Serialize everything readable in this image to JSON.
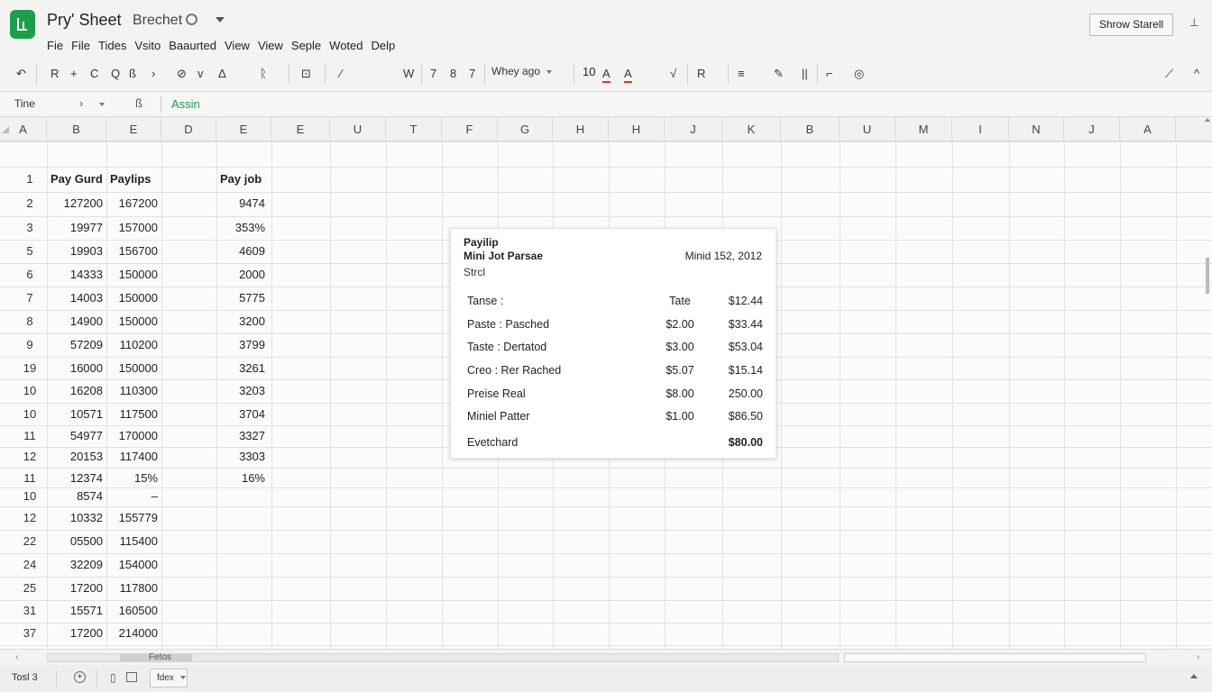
{
  "titlebar": {
    "doc_title": "Pry' Sheet",
    "doc_sub": "Brechet",
    "share_button": "Shrow Starell",
    "pin": "⊥"
  },
  "menu": [
    "Fie",
    "File",
    "Tides",
    "Vsito",
    "Baaurted",
    "View",
    "View",
    "Seple",
    "Woted",
    "Delp"
  ],
  "toolbar": {
    "items": [
      {
        "icon": "undo-icon",
        "glyph": "↶"
      },
      {
        "icon": "redo-icon",
        "glyph": "R"
      },
      {
        "icon": "add-icon",
        "glyph": "+"
      },
      {
        "icon": "refresh-icon",
        "glyph": "C"
      },
      {
        "icon": "search-icon",
        "glyph": "Q"
      },
      {
        "icon": "paint-icon",
        "glyph": "ß"
      },
      {
        "icon": "arrow-icon",
        "glyph": "›"
      },
      {
        "icon": "link-icon",
        "glyph": "⊘"
      },
      {
        "icon": "chevron-icon",
        "glyph": "v"
      },
      {
        "icon": "triangle-icon",
        "glyph": "Δ"
      },
      {
        "icon": "sum-icon",
        "glyph": "ᚱ"
      },
      {
        "icon": "comment-icon",
        "glyph": "⊡"
      },
      {
        "icon": "edit-icon",
        "glyph": "∕"
      },
      {
        "icon": "wrap-icon",
        "glyph": "W"
      },
      {
        "icon": "format-7-icon",
        "glyph": "7"
      },
      {
        "icon": "format-8-icon",
        "glyph": "8"
      },
      {
        "icon": "format-7b-icon",
        "glyph": "7"
      }
    ],
    "font_name": "Whey ago",
    "font_size": "10",
    "right_items": [
      "A",
      "A",
      "√",
      "R",
      "≡",
      "✎",
      "||",
      "⌐",
      "◎"
    ]
  },
  "formula_bar": {
    "name_box": "Tine",
    "value": "Assin"
  },
  "columns": [
    "A",
    "B",
    "E",
    "D",
    "E",
    "E",
    "U",
    "T",
    "F",
    "G",
    "H",
    "H",
    "J",
    "K",
    "B",
    "U",
    "M",
    "I",
    "N",
    "J",
    "A"
  ],
  "rows": [
    {
      "num": "1",
      "b": "Pay Gurd",
      "c": "Paylips",
      "e": "Pay job",
      "bold": true
    },
    {
      "num": "2",
      "b": "127200",
      "c": "167200",
      "e": "9474"
    },
    {
      "num": "3",
      "b": "19977",
      "c": "157000",
      "e": "353%"
    },
    {
      "num": "5",
      "b": "19903",
      "c": "156700",
      "e": "4609"
    },
    {
      "num": "6",
      "b": "14333",
      "c": "150000",
      "e": "2000"
    },
    {
      "num": "7",
      "b": "14003",
      "c": "150000",
      "e": "5775"
    },
    {
      "num": "8",
      "b": "14900",
      "c": "150000",
      "e": "3200"
    },
    {
      "num": "9",
      "b": "57209",
      "c": "110200",
      "e": "3799"
    },
    {
      "num": "19",
      "b": "16000",
      "c": "150000",
      "e": "3261"
    },
    {
      "num": "10",
      "b": "16208",
      "c": "110300",
      "e": "3203"
    },
    {
      "num": "10",
      "b": "10571",
      "c": "117500",
      "e": "3704"
    },
    {
      "num": "11",
      "b": "54977",
      "c": "170000",
      "e": "3327"
    },
    {
      "num": "12",
      "b": "20153",
      "c": "117400",
      "e": "3303"
    },
    {
      "num": "11",
      "b": "12374",
      "c": "15%",
      "e": "16%"
    },
    {
      "num": "10",
      "b": "8574",
      "c": "–",
      "e": ""
    },
    {
      "num": "12",
      "b": "10332",
      "c": "155779",
      "e": ""
    },
    {
      "num": "22",
      "b": "05500",
      "c": "115400",
      "e": ""
    },
    {
      "num": "24",
      "b": "32209",
      "c": "154000",
      "e": ""
    },
    {
      "num": "25",
      "b": "17200",
      "c": "117800",
      "e": ""
    },
    {
      "num": "31",
      "b": "15571",
      "c": "160500",
      "e": ""
    },
    {
      "num": "37",
      "b": "17200",
      "c": "214000",
      "e": ""
    }
  ],
  "card": {
    "title": "Payilip",
    "subtitle": "Mini Jot Parsae",
    "date": "Minid 152, 2012",
    "caption": "Strcl",
    "lines": [
      {
        "label": "Tanse :",
        "mid": "Tate",
        "value": "$12.44"
      },
      {
        "label": "Paste : Pasched",
        "mid": "$2.00",
        "value": "$33.44"
      },
      {
        "label": "Taste : Dertatod",
        "mid": "$3.00",
        "value": "$53.04"
      },
      {
        "label": "Creo : Rer Rached",
        "mid": "$5.07",
        "value": "$15.14"
      },
      {
        "label": "Preise Real",
        "mid": "$8.00",
        "value": "250.00"
      },
      {
        "label": "Miniel Patter",
        "mid": "$1.00",
        "value": "$86.50"
      }
    ],
    "total_label": "Evetchard",
    "total_value": "$80.00"
  },
  "scrollbar": {
    "label": "Fetos"
  },
  "tabs": {
    "status": "Tosl 3",
    "sheet_tab": "fdex"
  }
}
